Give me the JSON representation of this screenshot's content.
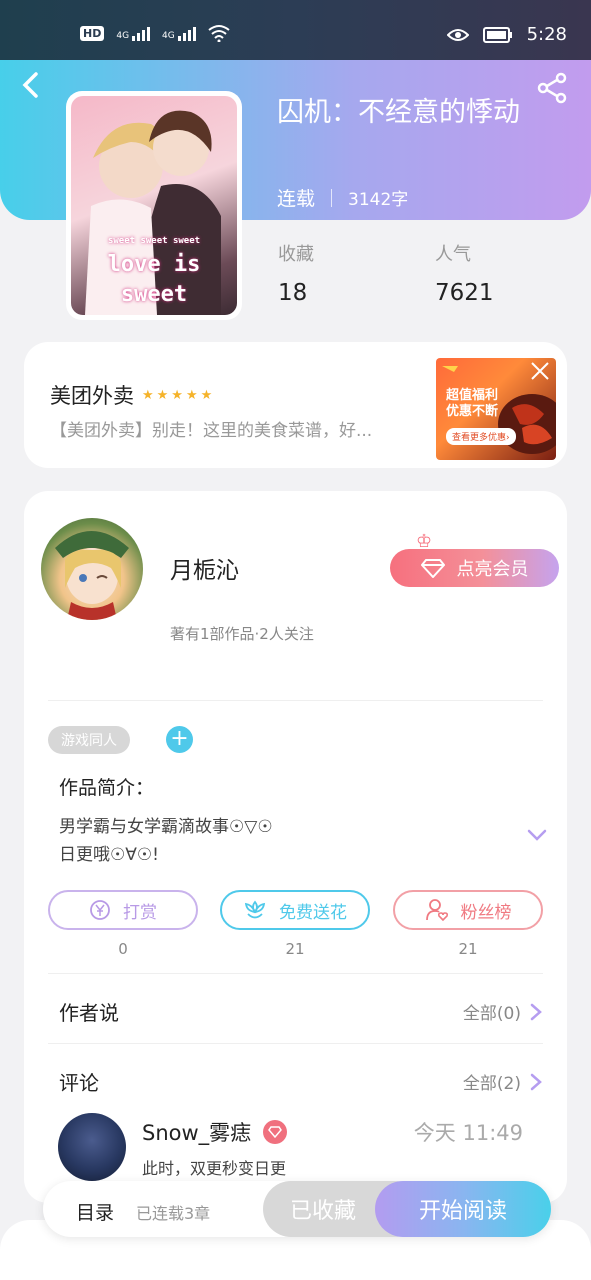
{
  "status_bar": {
    "hd_label": "HD",
    "hd_sub": "2",
    "net1": "4G",
    "net2": "4G",
    "time": "5:28"
  },
  "book": {
    "title": "囚机：不经意的悸动",
    "status": "连载",
    "word_count": "3142字",
    "cover_text_top": "sweet sweet sweet",
    "cover_text_1": "love is",
    "cover_text_2": "sweet"
  },
  "stats": [
    {
      "label": "收藏",
      "value": "18"
    },
    {
      "label": "人气",
      "value": "7621"
    }
  ],
  "ad": {
    "title": "美团外卖",
    "stars": "★★★★★",
    "description": "【美团外卖】别走！这里的美食菜谱，好...",
    "img_line1": "超值福利",
    "img_line2": "优惠不断",
    "img_button": "查看更多优惠›"
  },
  "author": {
    "name": "月栀沁",
    "vip_button": "点亮会员",
    "meta": "著有1部作品·2人关注"
  },
  "tags": [
    "游戏同人"
  ],
  "intro": {
    "label": "作品简介：",
    "line1": "男学霸与女学霸滴故事☉▽☉",
    "line2": "日更哦☉∀☉!"
  },
  "actions": [
    {
      "label": "打赏",
      "count": "0",
      "color": "#b89ae6"
    },
    {
      "label": "免费送花",
      "count": "21",
      "color": "#4fc9ea"
    },
    {
      "label": "粉丝榜",
      "count": "21",
      "color": "#f07a82"
    }
  ],
  "author_says": {
    "title": "作者说",
    "more": "全部(0)"
  },
  "comments": {
    "title": "评论",
    "more": "全部(2)",
    "items": [
      {
        "user": "Snow_雾痣",
        "time": "今天 11:49",
        "text": "此时，双更秒变日更"
      }
    ]
  },
  "bottom": {
    "toc": "目录",
    "toc_sub": "已连载3章",
    "collected": "已收藏",
    "read": "开始阅读"
  }
}
